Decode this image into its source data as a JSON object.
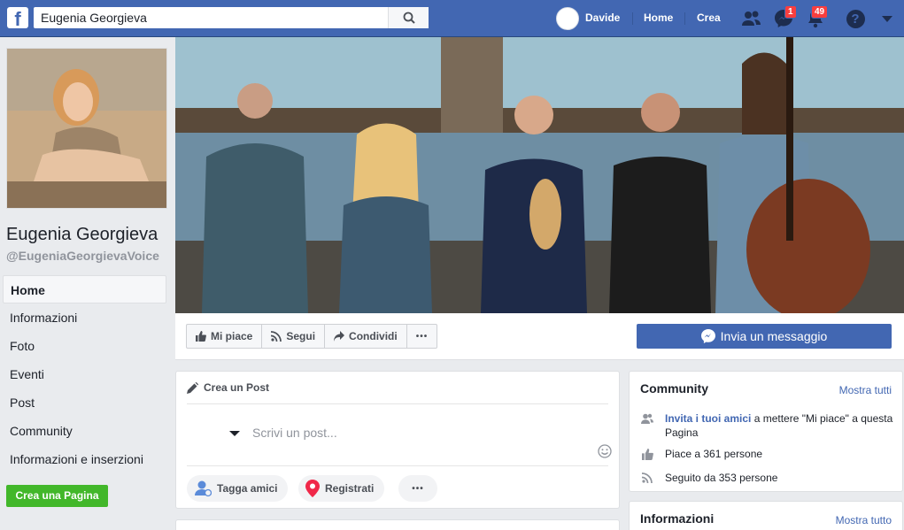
{
  "topbar": {
    "search_value": "Eugenia Georgieva",
    "user_name": "Davide",
    "home_label": "Home",
    "create_label": "Crea",
    "messages_badge": "1",
    "notifications_badge": "49",
    "help_label": "?"
  },
  "page": {
    "name": "Eugenia Georgieva",
    "handle": "@EugeniaGeorgievaVoice"
  },
  "left_nav": {
    "items": [
      "Home",
      "Informazioni",
      "Foto",
      "Eventi",
      "Post",
      "Community",
      "Informazioni e inserzioni"
    ],
    "create_page": "Crea una Pagina"
  },
  "actions": {
    "like": "Mi piace",
    "follow": "Segui",
    "share": "Condividi",
    "more": "•••",
    "message": "Invia un messaggio"
  },
  "composer": {
    "title": "Crea un Post",
    "placeholder": "Scrivi un post...",
    "tag_friends": "Tagga amici",
    "check_in": "Registrati",
    "more": "•••"
  },
  "community": {
    "title": "Community",
    "see_all": "Mostra tutti",
    "invite_link": "Invita i tuoi amici",
    "invite_rest": " a mettere \"Mi piace\" a questa Pagina",
    "likes": "Piace a 361 persone",
    "follows": "Seguito da 353 persone"
  },
  "about": {
    "title": "Informazioni",
    "see_all": "Mostra tutto"
  },
  "colors": {
    "brand_blue": "#4267b2",
    "create_green": "#42b72a",
    "badge_red": "#fa3e3e"
  }
}
